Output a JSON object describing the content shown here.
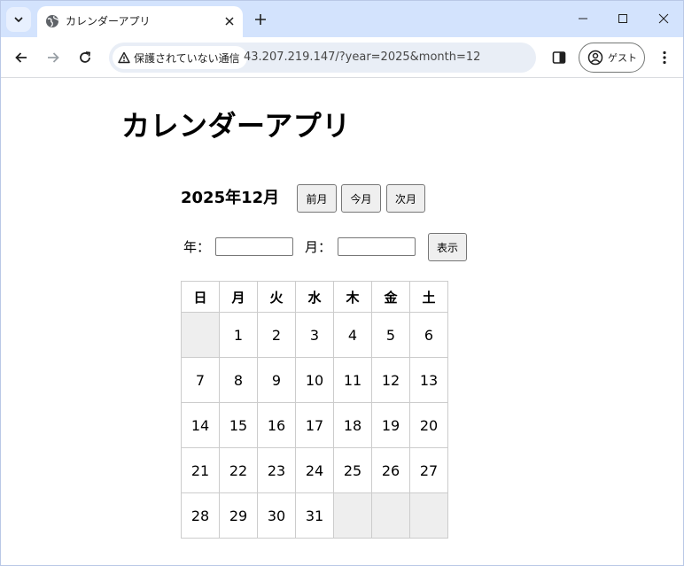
{
  "browser": {
    "tab_title": "カレンダーアプリ",
    "security_label": "保護されていない通信",
    "url": "43.207.219.147/?year=2025&month=12",
    "profile_label": "ゲスト"
  },
  "app": {
    "title": "カレンダーアプリ",
    "month_label": "2025年12月",
    "prev_button": "前月",
    "today_button": "今月",
    "next_button": "次月",
    "year_label": "年：",
    "month_field_label": "月：",
    "year_value": "",
    "month_value": "",
    "show_button": "表示"
  },
  "calendar": {
    "weekdays": [
      "日",
      "月",
      "火",
      "水",
      "木",
      "金",
      "土"
    ],
    "weeks": [
      [
        "",
        "1",
        "2",
        "3",
        "4",
        "5",
        "6"
      ],
      [
        "7",
        "8",
        "9",
        "10",
        "11",
        "12",
        "13"
      ],
      [
        "14",
        "15",
        "16",
        "17",
        "18",
        "19",
        "20"
      ],
      [
        "21",
        "22",
        "23",
        "24",
        "25",
        "26",
        "27"
      ],
      [
        "28",
        "29",
        "30",
        "31",
        "",
        "",
        ""
      ]
    ]
  }
}
